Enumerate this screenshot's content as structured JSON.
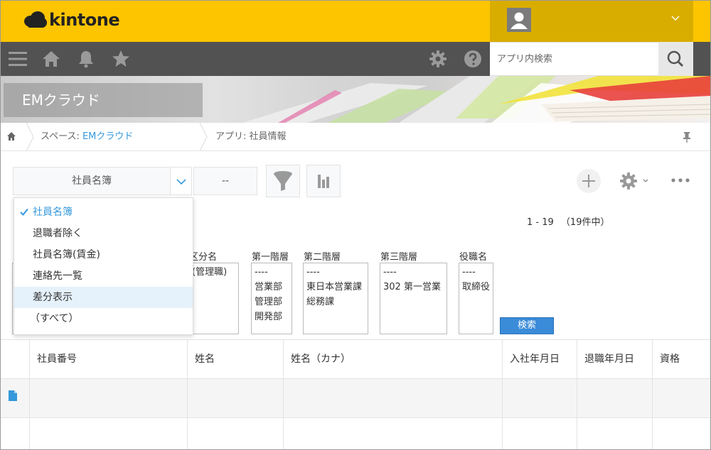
{
  "header": {
    "logo_text": "kintone",
    "brand_color": "#fdc500",
    "search_placeholder": "アプリ内検索"
  },
  "banner": {
    "space_name": "EMクラウド"
  },
  "breadcrumb": {
    "space_prefix": "スペース: ",
    "space_link": "EMクラウド",
    "app_label": "アプリ: 社員情報"
  },
  "toolbar": {
    "selected_view": "社員名簿",
    "filter_value": "--"
  },
  "views_menu": {
    "items": [
      {
        "label": "社員名簿",
        "selected": true
      },
      {
        "label": "退職者除く"
      },
      {
        "label": "社員名簿(賃金)"
      },
      {
        "label": "連絡先一覧"
      },
      {
        "label": "差分表示"
      },
      {
        "label": "（すべて）"
      }
    ]
  },
  "pager": {
    "range": "1 - 19",
    "total": "（19件中）"
  },
  "filter": {
    "columns": [
      {
        "label": "区分名",
        "options": [
          "(管理職)"
        ]
      },
      {
        "label": "第一階層",
        "options": [
          "----",
          "営業部",
          "管理部",
          "開発部"
        ]
      },
      {
        "label": "第二階層",
        "options": [
          "----",
          "東日本営業課",
          "総務課"
        ]
      },
      {
        "label": "第三階層",
        "options": [
          "----",
          "302 第一営業"
        ]
      },
      {
        "label": "役職名",
        "options": [
          "----",
          "取締役"
        ]
      }
    ],
    "search_button": "検索"
  },
  "table": {
    "headers": [
      "社員番号",
      "姓名",
      "姓名（カナ）",
      "入社年月日",
      "退職年月日",
      "資格"
    ]
  }
}
